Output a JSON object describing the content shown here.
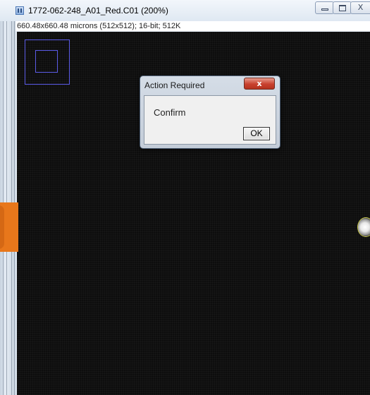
{
  "window": {
    "title": "1772-062-248_A01_Red.C01 (200%)",
    "info": "660.48x660.48 microns (512x512); 16-bit; 512K",
    "close_glyph": "X",
    "icons": {
      "app": "imagej-window-icon",
      "minimize": "minimize-icon",
      "maximize": "maximize-icon",
      "close": "close-icon"
    }
  },
  "dialog": {
    "title": "Action Required",
    "message": "Confirm",
    "ok_label": "OK",
    "close_glyph": "x"
  },
  "colors": {
    "canvas": "#0d0d0d",
    "navigator_box": "#5a5ae6",
    "orange_tab": "#e8771b",
    "dialog_close": "#c8412e"
  }
}
